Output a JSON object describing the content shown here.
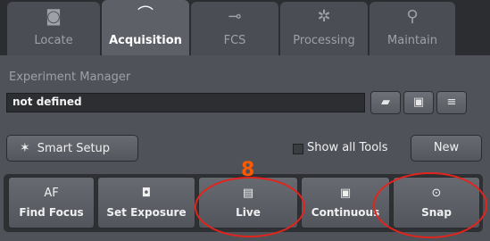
{
  "tabs": [
    {
      "label": "Locate",
      "icon": "locate-icon",
      "glyph": "◙"
    },
    {
      "label": "Acquisition",
      "icon": "acquisition-icon",
      "glyph": "⌒",
      "active": true
    },
    {
      "label": "FCS",
      "icon": "fcs-icon",
      "glyph": "⊸"
    },
    {
      "label": "Processing",
      "icon": "processing-icon",
      "glyph": "✲"
    },
    {
      "label": "Maintain",
      "icon": "maintain-icon",
      "glyph": "⚲"
    }
  ],
  "experiment_manager": {
    "title": "Experiment Manager",
    "value": "not defined",
    "buttons": [
      {
        "icon": "open-folder-icon",
        "glyph": "▰"
      },
      {
        "icon": "save-icon",
        "glyph": "▣"
      },
      {
        "icon": "delete-icon",
        "glyph": "≡"
      }
    ]
  },
  "toolbar": {
    "smart_setup_label": "Smart Setup",
    "smart_setup_glyph": "✶",
    "show_all_tools_label": "Show all Tools",
    "new_label": "New"
  },
  "actions": [
    {
      "top": "AF",
      "bottom": "Find Focus"
    },
    {
      "top": "◘",
      "bottom": "Set Exposure",
      "icon": "camera-exposure-icon"
    },
    {
      "top": "▤",
      "bottom": "Live",
      "icon": "live-icon"
    },
    {
      "top": "▣",
      "bottom": "Continuous",
      "icon": "continuous-icon"
    },
    {
      "top": "⊙",
      "bottom": "Snap",
      "icon": "snap-icon"
    }
  ],
  "annotation": {
    "number": "8",
    "color": "#e3241c"
  },
  "colors": {
    "panel": "#4f5359",
    "tabbar": "#2b2d31",
    "annotation": "#e3241c"
  }
}
